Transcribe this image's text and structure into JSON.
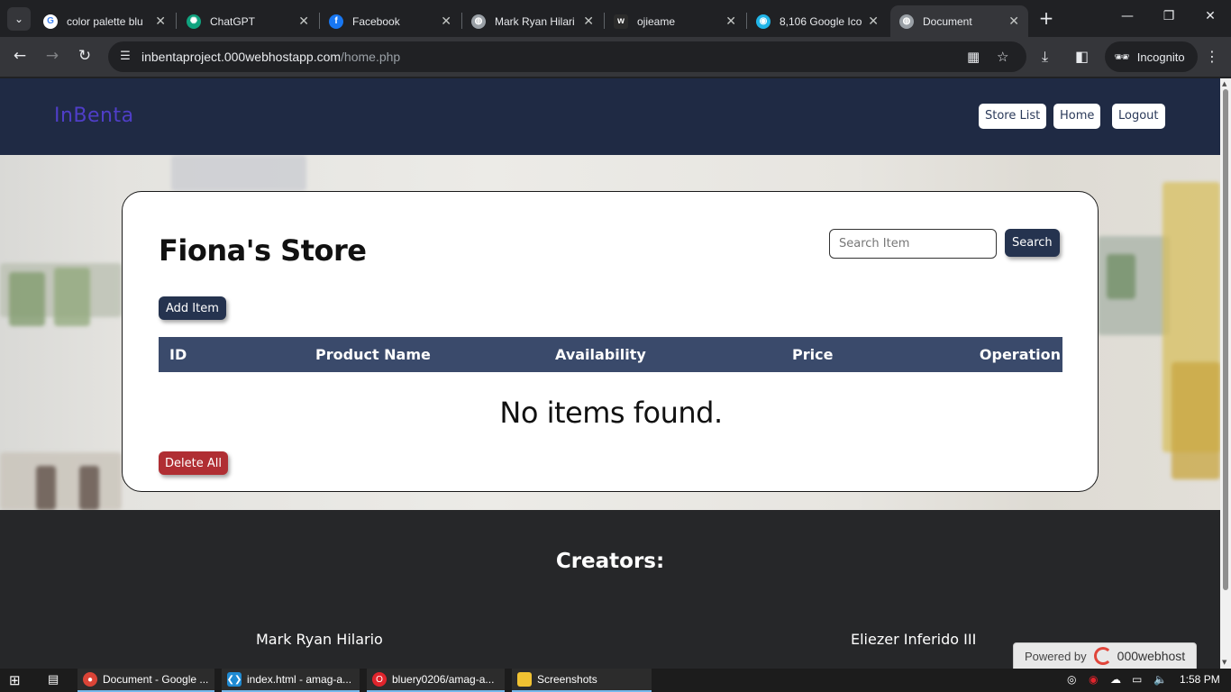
{
  "browser": {
    "tabs": [
      {
        "title": "color palette blu",
        "favicon": "google-icon",
        "color": "#4285f4"
      },
      {
        "title": "ChatGPT",
        "favicon": "chatgpt-icon",
        "color": "#10a37f"
      },
      {
        "title": "Facebook",
        "favicon": "facebook-icon",
        "color": "#1877f2"
      },
      {
        "title": "Mark Ryan Hilari",
        "favicon": "globe-icon",
        "color": "#9aa0a6"
      },
      {
        "title": "ojieame",
        "favicon": "webflow-icon",
        "color": "#2b2b2b"
      },
      {
        "title": "8,106 Google Ico",
        "favicon": "iconscout-icon",
        "color": "#21b5e8"
      },
      {
        "title": "Document",
        "favicon": "globe-icon",
        "color": "#9aa0a6"
      }
    ],
    "url_host": "inbentaproject.000webhostapp.com",
    "url_path": "/home.php",
    "incognito_label": "Incognito"
  },
  "site": {
    "logo": "InBenta",
    "nav": [
      "Store List",
      "Home",
      "Logout"
    ],
    "store_title": "Fiona's Store",
    "search_placeholder": "Search Item",
    "search_button": "Search",
    "add_button": "Add Item",
    "table_headers": [
      "ID",
      "Product Name",
      "Availability",
      "Price",
      "Operation"
    ],
    "empty_message": "No items found.",
    "delete_all_button": "Delete All"
  },
  "footer": {
    "heading": "Creators:",
    "creators": [
      "Mark Ryan Hilario",
      "Eliezer Inferido III"
    ]
  },
  "badge": {
    "powered_by": "Powered by",
    "brand": "000webhost"
  },
  "taskbar": {
    "items": [
      "Document - Google ...",
      "index.html - amag-a...",
      "bluery0206/amag-a...",
      "Screenshots"
    ],
    "time": "1:58 PM"
  },
  "colors": {
    "nav_bg": "#1f2a44",
    "logo": "#4f3ec8",
    "button_dark": "#25334f",
    "table_header": "#3a4a6b",
    "danger": "#b02e33",
    "footer_bg": "#262729"
  }
}
